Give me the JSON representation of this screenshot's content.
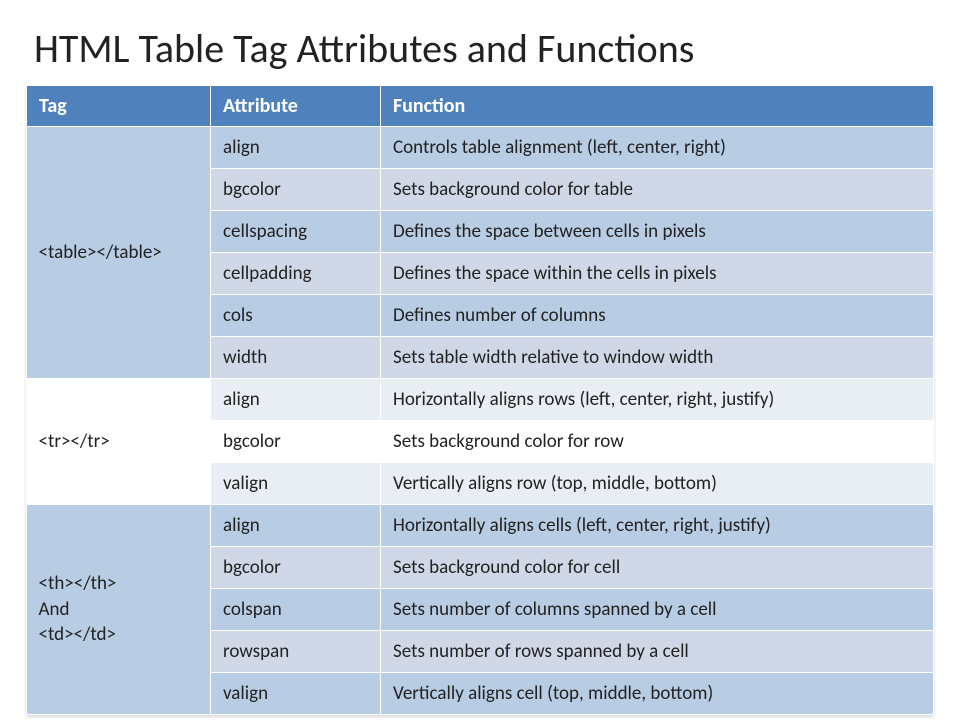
{
  "title": "HTML Table Tag Attributes and Functions",
  "headers": {
    "col1": "Tag",
    "col2": "Attribute",
    "col3": "Function"
  },
  "groups": [
    {
      "tag": "<table></table>",
      "rows": [
        {
          "attr": "align",
          "func": "Controls table alignment (left, center, right)"
        },
        {
          "attr": "bgcolor",
          "func": "Sets background color for table"
        },
        {
          "attr": "cellspacing",
          "func": "Defines the space between cells in pixels"
        },
        {
          "attr": "cellpadding",
          "func": "Defines the space within the cells in pixels"
        },
        {
          "attr": "cols",
          "func": "Defines number of columns"
        },
        {
          "attr": "width",
          "func": "Sets table width relative to window width"
        }
      ]
    },
    {
      "tag": "<tr></tr>",
      "rows": [
        {
          "attr": "align",
          "func": "Horizontally aligns rows (left, center, right, justify)"
        },
        {
          "attr": "bgcolor",
          "func": "Sets background color for row"
        },
        {
          "attr": "valign",
          "func": "Vertically aligns row (top, middle, bottom)"
        }
      ]
    },
    {
      "tag": "<th></th>\nAnd\n<td></td>",
      "rows": [
        {
          "attr": "align",
          "func": "Horizontally aligns cells (left, center, right,  justify)"
        },
        {
          "attr": "bgcolor",
          "func": "Sets background color for cell"
        },
        {
          "attr": "colspan",
          "func": "Sets number of columns spanned by a cell"
        },
        {
          "attr": "rowspan",
          "func": "Sets number of rows spanned by a cell"
        },
        {
          "attr": "valign",
          "func": "Vertically aligns cell (top, middle, bottom)"
        }
      ]
    }
  ]
}
